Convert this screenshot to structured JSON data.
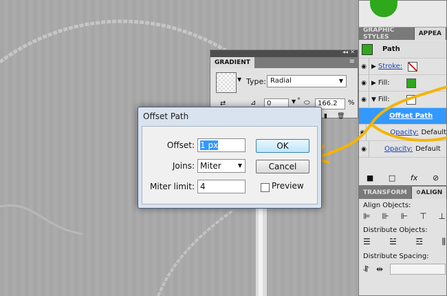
{
  "gradient_panel": {
    "title": "GRADIENT",
    "type_label": "Type:",
    "type_value": "Radial",
    "angle_value": "0",
    "degree_sign": "°",
    "aspect_value": "166.2",
    "percent_sign": "%"
  },
  "graphic_styles_panel": {
    "tabs": [
      "GRAPHIC STYLES",
      "APPEA"
    ],
    "path_label": "Path",
    "stroke_label": "Stroke:",
    "fill_label": "Fill:",
    "fill2_label": "Fill:",
    "offset_path_label": "Offset Path",
    "opacity_label": "Opacity:",
    "opacity_value": "Default",
    "opacity2_label": "Opacity:",
    "opacity2_value": "Default"
  },
  "transform_panel": {
    "tabs": [
      "TRANSFORM",
      "ALIGN"
    ],
    "align_objects": "Align Objects:",
    "distribute_objects": "Distribute Objects:",
    "distribute_spacing": "Distribute Spacing:"
  },
  "dialog": {
    "title": "Offset Path",
    "offset_label": "Offset:",
    "offset_value": "1 px",
    "joins_label": "Joins:",
    "joins_value": "Miter",
    "miter_label": "Miter limit:",
    "miter_value": "4",
    "ok_label": "OK",
    "cancel_label": "Cancel",
    "preview_label": "Preview"
  },
  "colors": {
    "accent_green": "#2fa81c",
    "selected_blue": "#3399ff",
    "annotation_yellow": "#f4b400"
  }
}
